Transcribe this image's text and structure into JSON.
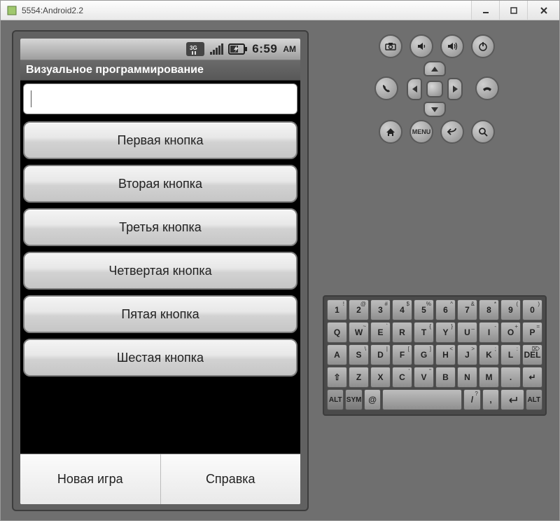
{
  "window": {
    "title": "5554:Android2.2"
  },
  "status_bar": {
    "icons": [
      "3G",
      "signal",
      "battery"
    ],
    "time": "6:59",
    "ampm": "AM"
  },
  "app": {
    "title": "Визуальное программирование",
    "input_value": "",
    "buttons": [
      "Первая кнопка",
      "Вторая кнопка",
      "Третья кнопка",
      "Четвертая кнопка",
      "Пятая кнопка",
      "Шестая кнопка"
    ],
    "options": {
      "left": "Новая игра",
      "right": "Справка"
    }
  },
  "hw_buttons": {
    "menu_label": "MENU"
  },
  "keyboard": {
    "row1": [
      {
        "main": "1",
        "sub": "!"
      },
      {
        "main": "2",
        "sub": "@"
      },
      {
        "main": "3",
        "sub": "#"
      },
      {
        "main": "4",
        "sub": "$"
      },
      {
        "main": "5",
        "sub": "%"
      },
      {
        "main": "6",
        "sub": "^"
      },
      {
        "main": "7",
        "sub": "&"
      },
      {
        "main": "8",
        "sub": "*"
      },
      {
        "main": "9",
        "sub": "("
      },
      {
        "main": "0",
        "sub": ")"
      }
    ],
    "row2": [
      {
        "main": "Q",
        "sub": ""
      },
      {
        "main": "W",
        "sub": "~"
      },
      {
        "main": "E",
        "sub": "`"
      },
      {
        "main": "R",
        "sub": ""
      },
      {
        "main": "T",
        "sub": "{"
      },
      {
        "main": "Y",
        "sub": "}"
      },
      {
        "main": "U",
        "sub": "_"
      },
      {
        "main": "I",
        "sub": "-"
      },
      {
        "main": "O",
        "sub": "+"
      },
      {
        "main": "P",
        "sub": "="
      }
    ],
    "row3": [
      {
        "main": "A",
        "sub": ""
      },
      {
        "main": "S",
        "sub": "\\"
      },
      {
        "main": "D",
        "sub": "|"
      },
      {
        "main": "F",
        "sub": "["
      },
      {
        "main": "G",
        "sub": "]"
      },
      {
        "main": "H",
        "sub": "<"
      },
      {
        "main": "J",
        "sub": ">"
      },
      {
        "main": "K",
        "sub": ";"
      },
      {
        "main": "L",
        "sub": ":"
      },
      {
        "main": "DEL",
        "sub": "⌦"
      }
    ],
    "row4": [
      {
        "main": "⇧",
        "sub": ""
      },
      {
        "main": "Z",
        "sub": ""
      },
      {
        "main": "X",
        "sub": ""
      },
      {
        "main": "C",
        "sub": "'"
      },
      {
        "main": "V",
        "sub": "\""
      },
      {
        "main": "B",
        "sub": ""
      },
      {
        "main": "N",
        "sub": ""
      },
      {
        "main": "M",
        "sub": ""
      },
      {
        "main": ".",
        "sub": ""
      },
      {
        "main": "↵",
        "sub": ""
      }
    ],
    "row5": {
      "alt": "ALT",
      "sym": "SYM",
      "at": "@",
      "space": "",
      "slash": "/",
      "comma": ",",
      "question": "?",
      "alt2": "ALT"
    }
  }
}
